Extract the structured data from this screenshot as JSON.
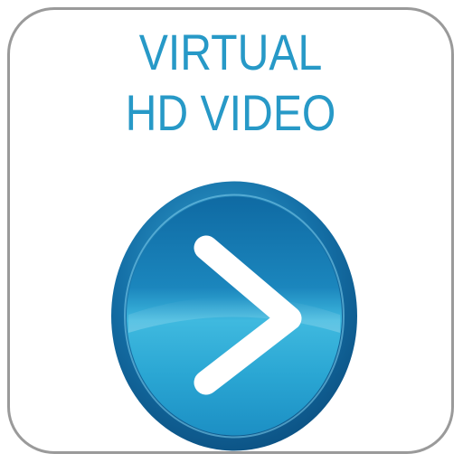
{
  "app_icon": {
    "title_line_1": "VIRTUAL",
    "title_line_2": "HD VIDEO",
    "play_icon": "chevron-right-icon",
    "colors": {
      "text": "#2799c7",
      "border": "#9a9a9a",
      "button_rim": "#0d5f95",
      "button_face": "#1f9ccc",
      "chevron": "#ffffff"
    }
  }
}
